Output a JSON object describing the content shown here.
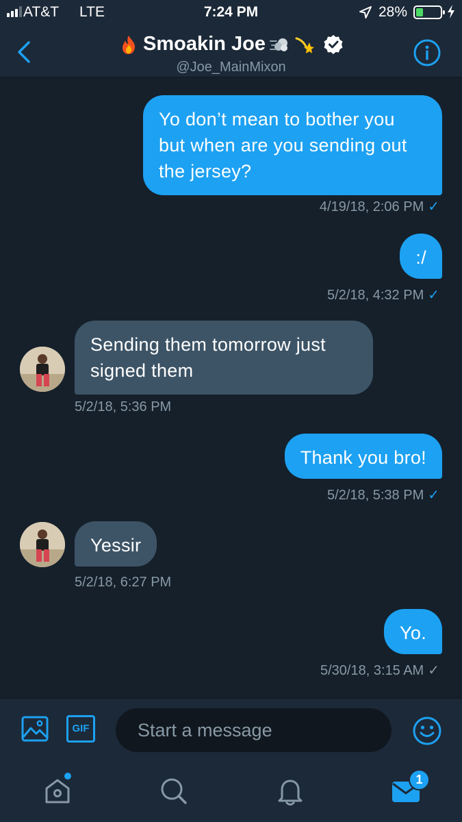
{
  "status_bar": {
    "carrier": "AT&T",
    "network": "LTE",
    "time": "7:24 PM",
    "battery_percent": "28%",
    "battery_level": 0.28,
    "signal_bars_filled": 3,
    "signal_bars_total": 4
  },
  "header": {
    "name": "Smoakin Joe",
    "handle": "@Joe_MainMixon",
    "verified": true,
    "name_emoji_icons": [
      "fire-icon",
      "dash-icon",
      "dizzy-icon"
    ]
  },
  "messages": [
    {
      "direction": "out",
      "text": "Yo don’t mean to bother you but when are you sending out the jersey?",
      "timestamp": "4/19/18, 2:06 PM",
      "read": true
    },
    {
      "direction": "out",
      "text": ":/",
      "timestamp": "5/2/18, 4:32 PM",
      "read": true
    },
    {
      "direction": "in",
      "text": "Sending them tomorrow just signed them",
      "timestamp": "5/2/18, 5:36 PM"
    },
    {
      "direction": "out",
      "text": "Thank you bro!",
      "timestamp": "5/2/18, 5:38 PM",
      "read": true
    },
    {
      "direction": "in",
      "text": "Yessir",
      "timestamp": "5/2/18, 6:27 PM"
    },
    {
      "direction": "out",
      "text": "Yo.",
      "timestamp": "5/30/18, 3:15 AM",
      "read": false
    }
  ],
  "composer": {
    "placeholder": "Start a message",
    "gif_label": "GIF"
  },
  "tab_bar": {
    "messages_badge": "1",
    "home_has_dot": true,
    "tabs": [
      "home-icon",
      "search-icon",
      "bell-icon",
      "mail-icon"
    ]
  },
  "colors": {
    "background": "#15202b",
    "bar": "#1c2938",
    "accent": "#1da1f2",
    "incoming_bubble": "#3d5466",
    "muted_text": "#8899a6"
  }
}
